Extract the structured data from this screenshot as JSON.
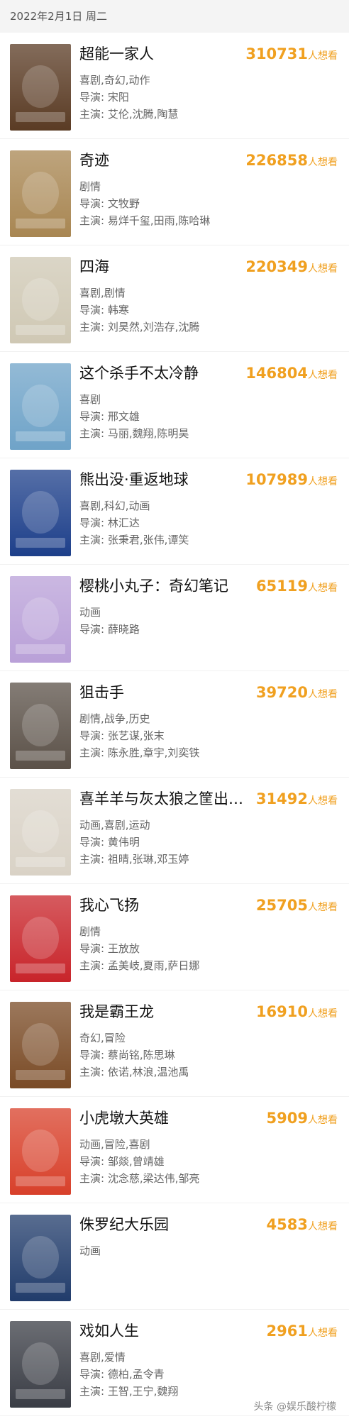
{
  "header": {
    "date": "2022年2月1日 周二"
  },
  "want_suffix": "人想看",
  "movies": [
    {
      "title": "超能一家人",
      "want": "310731",
      "genres": "喜剧,奇幻,动作",
      "director": "导演: 宋阳",
      "cast": "主演: 艾伦,沈腾,陶慧",
      "poster_color": "#5a3b24"
    },
    {
      "title": "奇迹",
      "want": "226858",
      "genres": "剧情",
      "director": "导演: 文牧野",
      "cast": "主演: 易烊千玺,田雨,陈哈琳",
      "poster_color": "#a88652"
    },
    {
      "title": "四海",
      "want": "220349",
      "genres": "喜剧,剧情",
      "director": "导演: 韩寒",
      "cast": "主演: 刘昊然,刘浩存,沈腾",
      "poster_color": "#cfc8b4"
    },
    {
      "title": "这个杀手不太冷静",
      "want": "146804",
      "genres": "喜剧",
      "director": "导演: 邢文雄",
      "cast": "主演: 马丽,魏翔,陈明昊",
      "poster_color": "#6fa3c8"
    },
    {
      "title": "熊出没·重返地球",
      "want": "107989",
      "genres": "喜剧,科幻,动画",
      "director": "导演: 林汇达",
      "cast": "主演: 张秉君,张伟,谭笑",
      "poster_color": "#1d3f8a"
    },
    {
      "title": "樱桃小丸子：奇幻笔记",
      "want": "65119",
      "genres": "动画",
      "director": "导演: 薛晓路",
      "cast": "",
      "poster_color": "#b9a0d8"
    },
    {
      "title": "狙击手",
      "want": "39720",
      "genres": "剧情,战争,历史",
      "director": "导演: 张艺谋,张末",
      "cast": "主演: 陈永胜,章宇,刘奕铁",
      "poster_color": "#5b5148"
    },
    {
      "title": "喜羊羊与灰太狼之筐出未来",
      "want": "31492",
      "genres": "动画,喜剧,运动",
      "director": "导演: 黄伟明",
      "cast": "主演: 祖晴,张琳,邓玉婷",
      "poster_color": "#d9d2c6"
    },
    {
      "title": "我心飞扬",
      "want": "25705",
      "genres": "剧情",
      "director": "导演: 王放放",
      "cast": "主演: 孟美岐,夏雨,萨日娜",
      "poster_color": "#c8242a"
    },
    {
      "title": "我是霸王龙",
      "want": "16910",
      "genres": "奇幻,冒险",
      "director": "导演: 蔡尚铭,陈思琳",
      "cast": "主演: 依诺,林浪,温池禹",
      "poster_color": "#7a4b26"
    },
    {
      "title": "小虎墩大英雄",
      "want": "5909",
      "genres": "动画,冒险,喜剧",
      "director": "导演: 邹燚,曾靖雄",
      "cast": "主演: 沈念慈,梁达伟,邹亮",
      "poster_color": "#d8402a"
    },
    {
      "title": "侏罗纪大乐园",
      "want": "4583",
      "genres": "动画",
      "director": "",
      "cast": "",
      "poster_color": "#213c6b"
    },
    {
      "title": "戏如人生",
      "want": "2961",
      "genres": "喜剧,爱情",
      "director": "导演: 德柏,孟令青",
      "cast": "主演: 王智,王宁,魏翔",
      "poster_color": "#3a3d45"
    }
  ],
  "watermark": "头条 @娱乐酸柠檬"
}
